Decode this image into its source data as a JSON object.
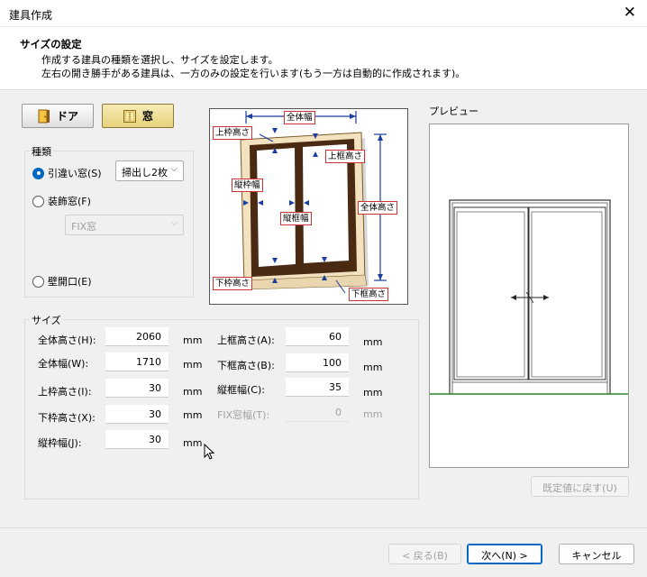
{
  "window": {
    "title": "建具作成",
    "close_glyph": "✕"
  },
  "header": {
    "title": "サイズの設定",
    "desc1": "作成する建具の種類を選択し、サイズを設定します。",
    "desc2": "左右の開き勝手がある建具は、一方のみの設定を行います(もう一方は自動的に作成されます)。"
  },
  "type_buttons": {
    "door_label": "ドア",
    "window_label": "窓",
    "selected": "窓"
  },
  "kind": {
    "group_label": "種類",
    "radio_sliding": "引違い窓(S)",
    "sliding_select": "掃出し2枚",
    "radio_fixed": "装飾窓(F)",
    "fixed_select": "FIX窓",
    "radio_opening": "壁開口(E)",
    "selected_radio": "引違い窓(S)"
  },
  "diagram": {
    "labels": {
      "overall_width": "全体幅",
      "top_frame_height": "上枠高さ",
      "top_rail_height": "上框高さ",
      "stile_width": "縦枠幅",
      "mullion_width": "縦框幅",
      "overall_height": "全体高さ",
      "bottom_frame_height": "下枠高さ",
      "bottom_rail_height": "下框高さ"
    }
  },
  "size": {
    "group_label": "サイズ",
    "unit": "mm",
    "left": [
      {
        "label": "全体高さ(H):",
        "value": "2060"
      },
      {
        "label": "全体幅(W):",
        "value": "1710"
      },
      {
        "label": "上枠高さ(I):",
        "value": "30"
      },
      {
        "label": "下枠高さ(X):",
        "value": "30"
      },
      {
        "label": "縦枠幅(J):",
        "value": "30"
      }
    ],
    "right": [
      {
        "label": "上框高さ(A):",
        "value": "60"
      },
      {
        "label": "下框高さ(B):",
        "value": "100"
      },
      {
        "label": "縦框幅(C):",
        "value": "35"
      },
      {
        "label": "FIX窓幅(T):",
        "value": "0"
      }
    ]
  },
  "preview": {
    "label": "プレビュー",
    "reset_button": "既定値に戻す(U)"
  },
  "footer": {
    "back_button": "< 戻る(B)",
    "next_button": "次へ(N) >",
    "cancel_button": "キャンセル"
  },
  "colors": {
    "accent": "#0067c0",
    "frame_brown": "#4a2a12",
    "window_button": "#e7d27a",
    "ground_line": "#2a8a2a"
  }
}
